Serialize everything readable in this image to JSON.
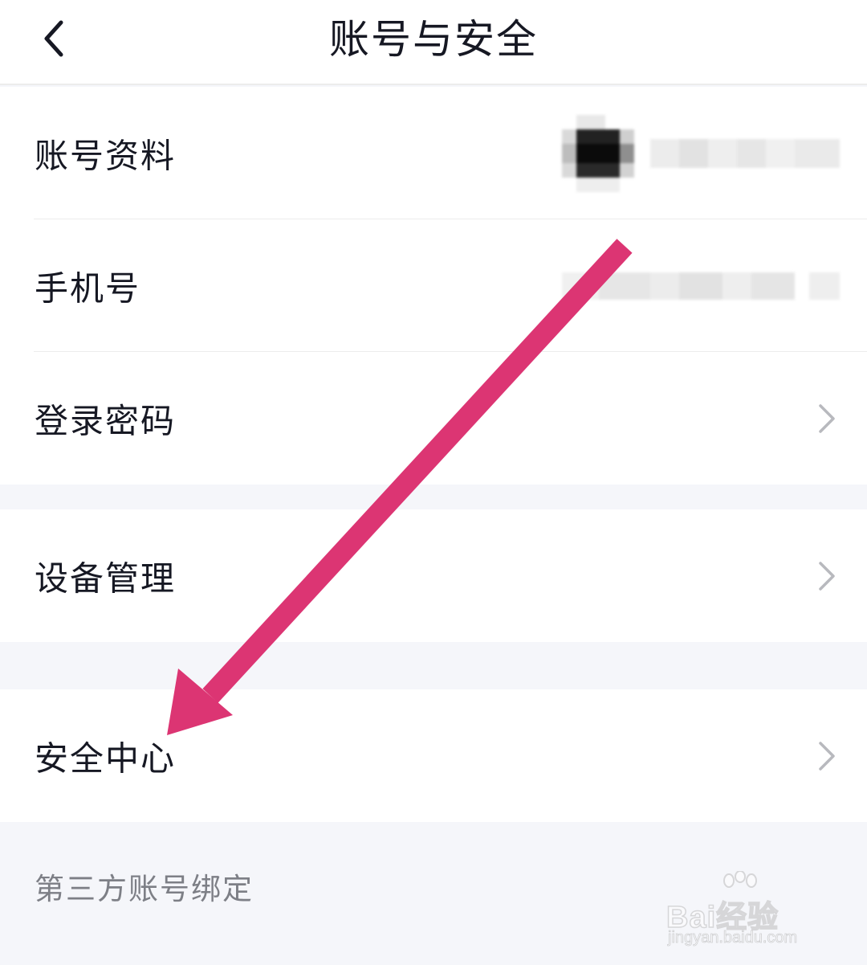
{
  "header": {
    "title": "账号与安全",
    "back_icon": "chevron-left-icon"
  },
  "groups": [
    {
      "items": [
        {
          "label": "账号资料",
          "value": "(blurred)"
        },
        {
          "label": "手机号",
          "value": "(blurred)"
        },
        {
          "label": "登录密码",
          "icon": "chevron-right-icon"
        }
      ]
    },
    {
      "items": [
        {
          "label": "设备管理",
          "icon": "chevron-right-icon"
        }
      ]
    },
    {
      "items": [
        {
          "label": "安全中心",
          "icon": "chevron-right-icon"
        }
      ]
    }
  ],
  "sections": {
    "third_party": "第三方账号绑定"
  },
  "annotation": {
    "arrow_color": "#dc3573",
    "arrow_icon": "pink-arrow-annotation"
  },
  "watermark": {
    "brand": "Bai经验",
    "url": "jingyan.baidu.com"
  },
  "colors": {
    "text_primary": "#161823",
    "text_secondary": "#7d7f86",
    "background": "#f5f6fa",
    "chevron": "#b8b9be"
  }
}
